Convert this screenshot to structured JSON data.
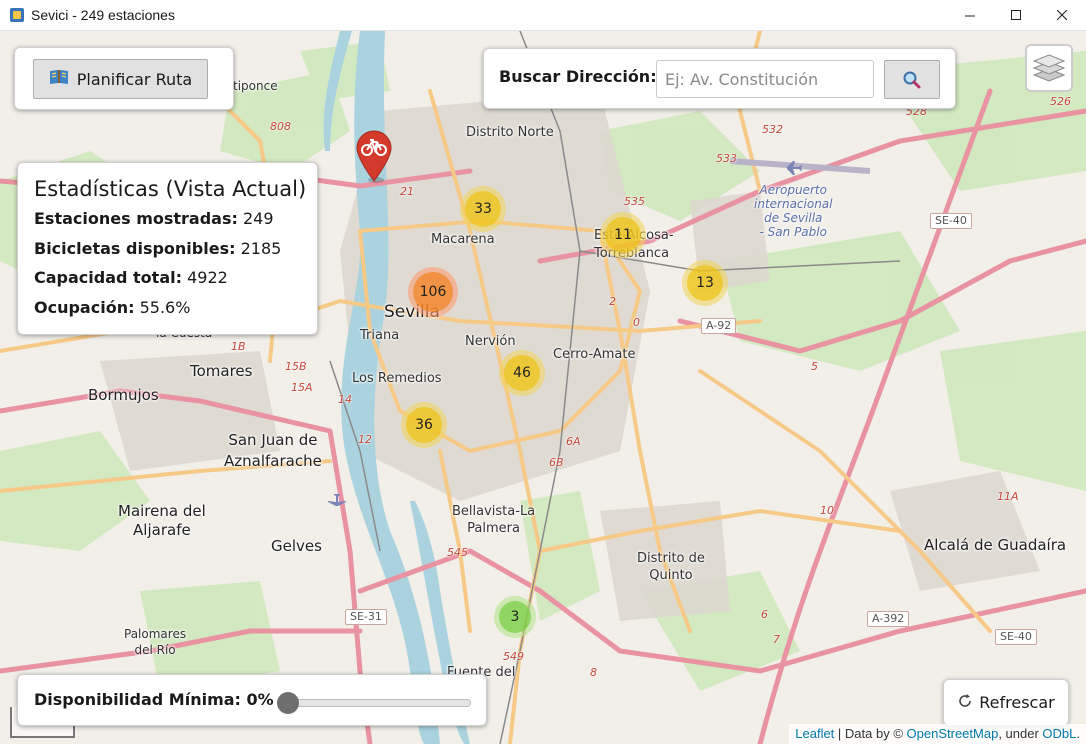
{
  "window": {
    "title": "Sevici - 249 estaciones",
    "controls": {
      "minimize": "minimize",
      "maximize": "maximize",
      "close": "close"
    }
  },
  "route": {
    "button_label": "Planificar Ruta",
    "icon": "map-book-icon"
  },
  "search": {
    "label": "Buscar Dirección:",
    "placeholder": "Ej: Av. Constitución",
    "value": "",
    "button_icon": "search-icon"
  },
  "layers": {
    "icon": "layers-icon"
  },
  "stats": {
    "title": "Estadísticas (Vista Actual)",
    "rows": [
      {
        "label": "Estaciones mostradas:",
        "value": "249"
      },
      {
        "label": "Bicicletas disponibles:",
        "value": "2185"
      },
      {
        "label": "Capacidad total:",
        "value": "4922"
      },
      {
        "label": "Ocupación:",
        "value": "55.6%"
      }
    ]
  },
  "filter": {
    "label": "Disponibilidad Mínima: 0%",
    "value_percent": 0
  },
  "refresh": {
    "label": "Refrescar",
    "icon": "refresh-icon"
  },
  "attribution": {
    "leaflet": "Leaflet",
    "separator": " | Data by © ",
    "osm": "OpenStreetMap",
    "under": ", under ",
    "license": "ODbL",
    "end": "."
  },
  "clusters": [
    {
      "count": "33",
      "level": "yellow"
    },
    {
      "count": "11",
      "level": "yellow"
    },
    {
      "count": "13",
      "level": "yellow"
    },
    {
      "count": "106",
      "level": "orange"
    },
    {
      "count": "46",
      "level": "yellow"
    },
    {
      "count": "36",
      "level": "yellow"
    },
    {
      "count": "3",
      "level": "green"
    }
  ],
  "marker": {
    "icon": "bicycle-icon",
    "color": "#d33a2c"
  },
  "map_labels": {
    "sevilla": "Sevilla",
    "distrito_norte": "Distrito Norte",
    "macarena": "Macarena",
    "triana": "Triana",
    "nervion": "Nervión",
    "cerro_amate": "Cerro-Amate",
    "los_remedios": "Los Remedios",
    "tomares": "Tomares",
    "bormujos": "Bormujos",
    "san_juan": "San Juan de\nAznalfarache",
    "mairena": "Mairena del\nAljarafe",
    "gelves": "Gelves",
    "bellavista": "Bellavista-La\nPalmera",
    "distrito_quinto": "Distrito de\nQuinto",
    "alcala": "Alcalá de Guadaíra",
    "palomares": "Palomares\ndel Río",
    "este": "Este-Alcosa-\nTorreblanca",
    "fuente": "Fuente del",
    "tipponce": "tiponce",
    "la_cuesta": "la Cuesta",
    "airport": "Aeropuerto\ninternacional\nde Sevilla\n- San Pablo"
  },
  "road_shields": [
    "SE-40",
    "A-92",
    "SE-31",
    "A-392",
    "SE-40"
  ],
  "road_numbers": [
    "808",
    "21",
    "526",
    "532",
    "533",
    "535",
    "528",
    "1B",
    "15B",
    "15A",
    "14",
    "12",
    "545",
    "549",
    "6A",
    "6B",
    "11A",
    "10",
    "5",
    "2",
    "0",
    "6",
    "7",
    "8"
  ],
  "colors": {
    "water": "#aad3df",
    "park": "#c8e6b0",
    "road_major": "#f7c987",
    "road_highway": "#e892a2",
    "land": "#f2efe9"
  }
}
